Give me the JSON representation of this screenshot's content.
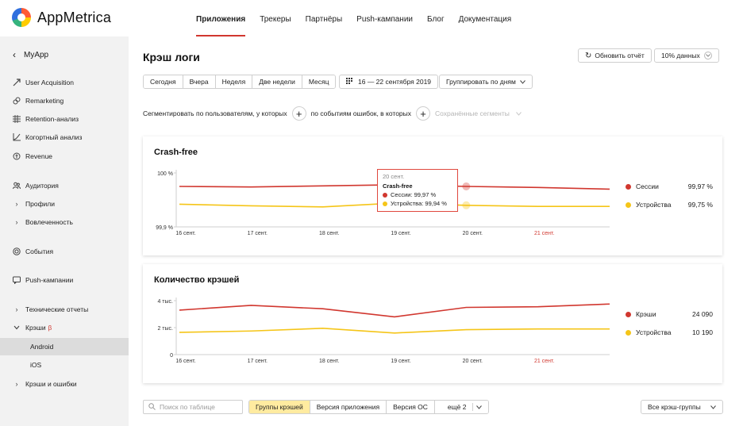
{
  "app": {
    "name": "AppMetrica"
  },
  "topnav": [
    "Приложения",
    "Трекеры",
    "Партнёры",
    "Push-кампании",
    "Блог",
    "Документация"
  ],
  "sidebar": {
    "back_label": "MyApp",
    "items": [
      {
        "label": "User Acquisition",
        "icon": "user-acquisition-icon"
      },
      {
        "label": "Remarketing",
        "icon": "remarketing-icon"
      },
      {
        "label": "Retention-анализ",
        "icon": "retention-icon"
      },
      {
        "label": "Когортный анализ",
        "icon": "cohort-icon"
      },
      {
        "label": "Revenue",
        "icon": "revenue-icon"
      },
      {
        "label": "Аудитория",
        "icon": "audience-icon"
      },
      {
        "label": "Профили",
        "icon": "chevron-right-icon"
      },
      {
        "label": "Вовлеченность",
        "icon": "chevron-right-icon"
      },
      {
        "label": "События",
        "icon": "events-icon"
      },
      {
        "label": "Push-кампании",
        "icon": "push-icon"
      },
      {
        "label": "Технические отчеты",
        "icon": "chevron-right-icon"
      },
      {
        "label": "Крэши",
        "icon": "chevron-down-icon",
        "badge": "β"
      },
      {
        "label": "Android",
        "sub": true,
        "selected": true
      },
      {
        "label": "iOS",
        "sub": true
      },
      {
        "label": "Крэши и ошибки",
        "icon": "chevron-right-icon"
      }
    ]
  },
  "page": {
    "title": "Крэш логи",
    "refresh_label": "Обновить отчёт",
    "sampling_label": "10% данных",
    "periods": [
      "Сегодня",
      "Вчера",
      "Неделя",
      "Две недели",
      "Месяц"
    ],
    "date_range": "16 — 22 сентября 2019",
    "group_by": "Группировать по дням",
    "segment_users": "Сегментировать по пользователям, у которых",
    "segment_events": "по событиям ошибок, в которых",
    "saved_segments": "Сохранённые сегменты"
  },
  "crash_free": {
    "title": "Crash-free",
    "legend": [
      {
        "name": "Сессии",
        "value": "99,97 %",
        "color": "#d1372f"
      },
      {
        "name": "Устройства",
        "value": "99,75 %",
        "color": "#f5c518"
      }
    ],
    "tooltip": {
      "date": "20 сент.",
      "title": "Crash-free",
      "rows": [
        "Сессии: 99,97 %",
        "Устройства: 99,94 %"
      ]
    }
  },
  "crash_count": {
    "title": "Количество крэшей",
    "legend": [
      {
        "name": "Крэши",
        "value": "24 090",
        "color": "#d1372f"
      },
      {
        "name": "Устройства",
        "value": "10 190",
        "color": "#f5c518"
      }
    ]
  },
  "chart_data": [
    {
      "type": "line",
      "title": "Crash-free",
      "categories": [
        "16 сент.",
        "17 сент.",
        "18 сент.",
        "19 сент.",
        "20 сент.",
        "21 сент.",
        ""
      ],
      "ylim": [
        99.9,
        100
      ],
      "yticks": [
        "100 %",
        "99,9 %"
      ],
      "series": [
        {
          "name": "Сессии",
          "color": "#d1372f",
          "values": [
            99.975,
            99.974,
            99.976,
            99.978,
            99.975,
            99.973,
            99.97
          ]
        },
        {
          "name": "Устройства",
          "color": "#f5c518",
          "values": [
            99.942,
            99.939,
            99.937,
            99.944,
            99.94,
            99.938,
            99.938
          ]
        }
      ],
      "highlight_index": 4
    },
    {
      "type": "line",
      "title": "Количество крэшей",
      "categories": [
        "16 сент.",
        "17 сент.",
        "18 сент.",
        "19 сент.",
        "20 сент.",
        "21 сент.",
        ""
      ],
      "ylim": [
        0,
        4000
      ],
      "yticks": [
        "4 тыс.",
        "2 тыс.",
        "0"
      ],
      "series": [
        {
          "name": "Крэши",
          "color": "#d1372f",
          "values": [
            3300,
            3650,
            3400,
            2800,
            3500,
            3550,
            3750
          ]
        },
        {
          "name": "Устройства",
          "color": "#f5c518",
          "values": [
            1650,
            1750,
            1950,
            1600,
            1850,
            1900,
            1900
          ]
        }
      ]
    }
  ],
  "bottom": {
    "search_placeholder": "Поиск по таблице",
    "tabs": [
      "Группы крэшей",
      "Версия приложения",
      "Версия ОС",
      "ещё 2"
    ],
    "groups_dropdown": "Все крэш-группы"
  }
}
